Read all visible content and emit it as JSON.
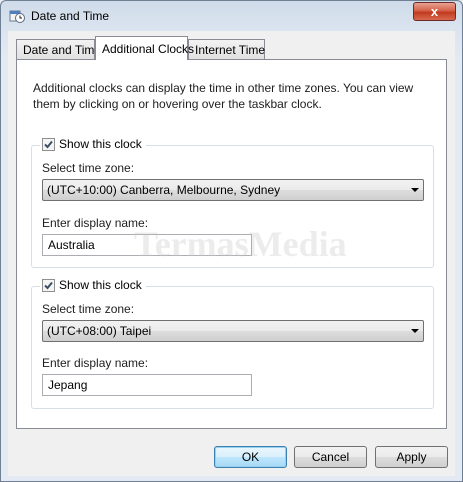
{
  "window": {
    "title": "Date and Time",
    "close_glyph": "x"
  },
  "tabs": [
    {
      "label": "Date and Time",
      "active": false
    },
    {
      "label": "Additional Clocks",
      "active": true
    },
    {
      "label": "Internet Time",
      "active": false
    }
  ],
  "additional_clocks": {
    "intro": "Additional clocks can display the time in other time zones. You can view them by clicking on or hovering over the taskbar clock.",
    "clocks": [
      {
        "show_label": "Show this clock",
        "checked": true,
        "timezone_label": "Select time zone:",
        "timezone_value": "(UTC+10:00) Canberra, Melbourne, Sydney",
        "display_name_label": "Enter display name:",
        "display_name_value": "Australia"
      },
      {
        "show_label": "Show this clock",
        "checked": true,
        "timezone_label": "Select time zone:",
        "timezone_value": "(UTC+08:00) Taipei",
        "display_name_label": "Enter display name:",
        "display_name_value": "Jepang"
      }
    ]
  },
  "buttons": {
    "ok": "OK",
    "cancel": "Cancel",
    "apply": "Apply"
  },
  "watermark": "TermasMedia",
  "colors": {
    "close_button": "#c23a1f",
    "default_button_border": "#3c7fb1",
    "checkmark": "#3d4e66"
  }
}
